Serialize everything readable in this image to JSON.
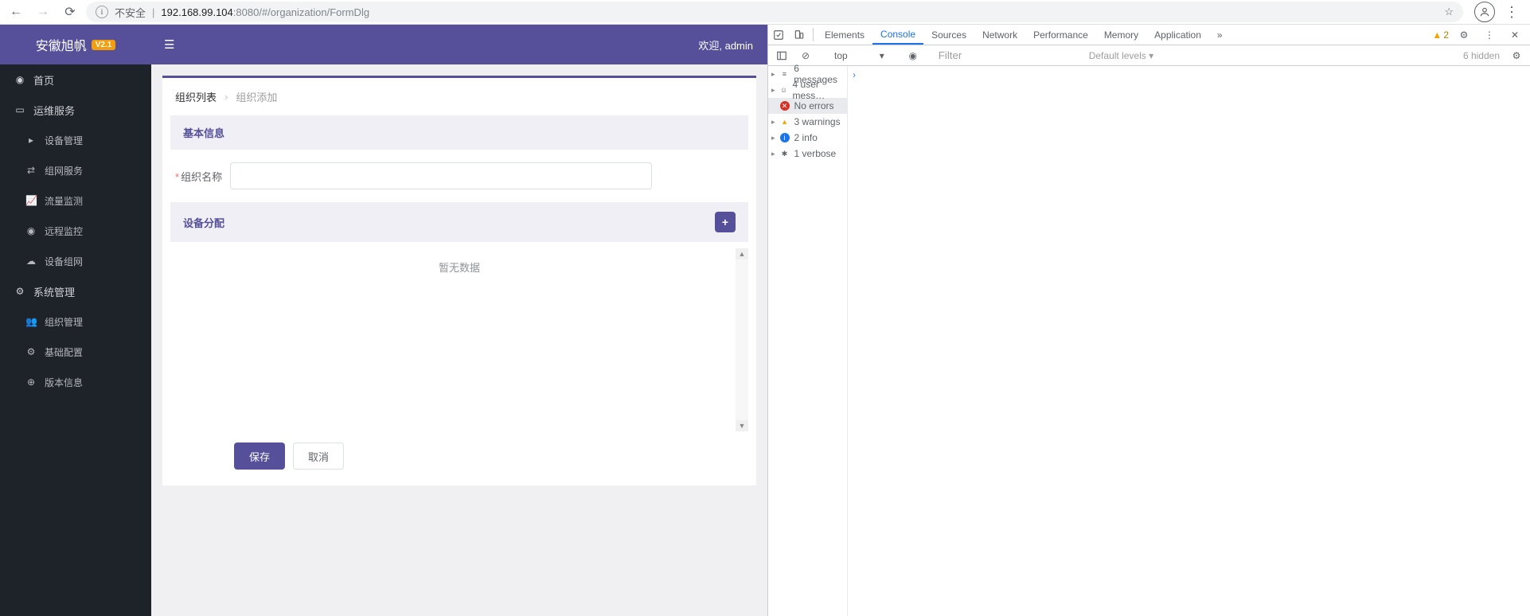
{
  "browser": {
    "insecure_label": "不安全",
    "url_prefix": "192.168.99.104",
    "url_port": ":8080",
    "url_path": "/#/organization/FormDlg"
  },
  "app": {
    "logo": "安徽旭帆",
    "version_badge": "V2.1",
    "welcome": "欢迎, admin",
    "menu": {
      "home": "首页",
      "ops": "运维服务",
      "ops_children": {
        "device_mgmt": "设备管理",
        "network_svc": "组网服务",
        "traffic_mon": "流量监测",
        "remote_mon": "远程监控",
        "device_net": "设备组网"
      },
      "sys": "系统管理",
      "sys_children": {
        "org_mgmt": "组织管理",
        "base_cfg": "基础配置",
        "ver_info": "版本信息"
      }
    },
    "breadcrumb": {
      "list": "组织列表",
      "add": "组织添加"
    },
    "sections": {
      "basic": "基本信息",
      "device": "设备分配"
    },
    "form": {
      "org_name_label": "组织名称",
      "empty_text": "暂无数据"
    },
    "buttons": {
      "save": "保存",
      "cancel": "取消"
    }
  },
  "devtools": {
    "tabs": {
      "elements": "Elements",
      "console": "Console",
      "sources": "Sources",
      "network": "Network",
      "performance": "Performance",
      "memory": "Memory",
      "application": "Application"
    },
    "warn_count": "2",
    "context": "top",
    "filter_placeholder": "Filter",
    "levels": "Default levels ▾",
    "hidden": "6 hidden",
    "side": {
      "messages": "6 messages",
      "user": "4 user mess…",
      "errors": "No errors",
      "warnings": "3 warnings",
      "info": "2 info",
      "verbose": "1 verbose"
    }
  }
}
